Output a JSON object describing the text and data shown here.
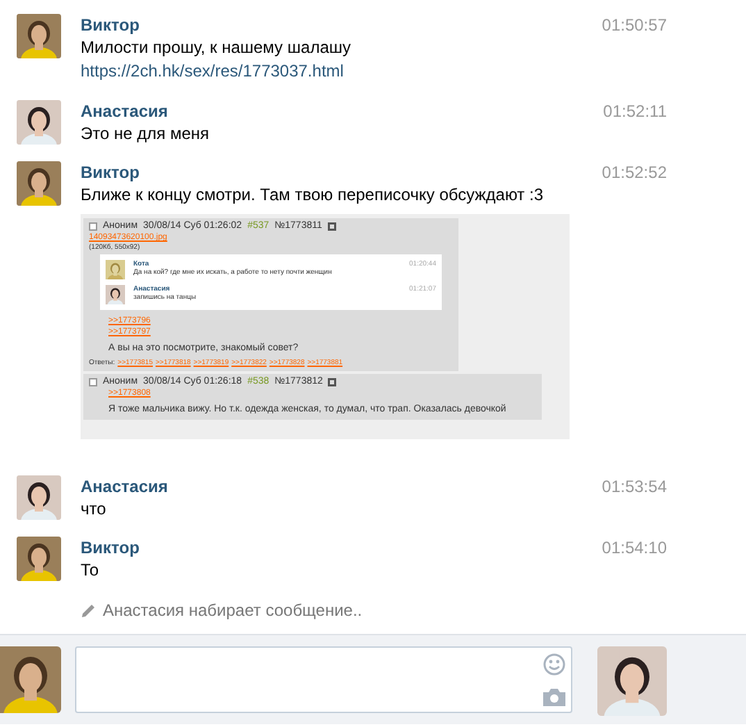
{
  "messages": [
    {
      "kind": "own",
      "author": "Виктор",
      "time": "01:50:57",
      "text": "Милости прошу, к нашему шалашу",
      "link": "https://2ch.hk/sex/res/1773037.html"
    },
    {
      "kind": "partner",
      "author": "Анастасия",
      "time": "01:52:11",
      "text": "Это не для меня"
    },
    {
      "kind": "own",
      "author": "Виктор",
      "time": "01:52:52",
      "text": "Ближе к концу смотри. Там твою переписочку обсуждают :3",
      "attachment": {
        "posts": [
          {
            "checked": false,
            "name": "Аноним",
            "date": "30/08/14 Суб 01:26:02",
            "num": "#537",
            "id": "№1773811",
            "file": "14093473620100.jpg",
            "file_info": "(120Кб, 550x92)",
            "chat": [
              {
                "kind": "cat",
                "author": "Кота",
                "time": "01:20:44",
                "text": "Да на кой? где мне их искать, а работе то нету почти женщин"
              },
              {
                "kind": "partner",
                "author": "Анастасия",
                "time": "01:21:07",
                "text": "запишись на танцы"
              }
            ],
            "refs": [
              ">>1773796",
              ">>1773797"
            ],
            "text": "А вы на это посмотрите, знакомый совет?",
            "replies_label": "Ответы:",
            "replies": [
              ">>1773815",
              ">>1773818",
              ">>1773819",
              ">>1773822",
              ">>1773828",
              ">>1773881"
            ]
          },
          {
            "checked": false,
            "name": "Аноним",
            "date": "30/08/14 Суб 01:26:18",
            "num": "#538",
            "id": "№1773812",
            "refs": [
              ">>1773808"
            ],
            "text": "Я тоже мальчика вижу. Но т.к. одежда женская, то думал, что трап. Оказалась девочкой"
          }
        ]
      }
    },
    {
      "kind": "partner",
      "author": "Анастасия",
      "time": "01:53:54",
      "text": "что"
    },
    {
      "kind": "own",
      "author": "Виктор",
      "time": "01:54:10",
      "text": "То"
    }
  ],
  "typing": "Анастасия набирает сообщение..",
  "composer": {
    "own_avatar": {
      "kind": "own"
    },
    "partner_avatar": {
      "kind": "partner"
    }
  }
}
